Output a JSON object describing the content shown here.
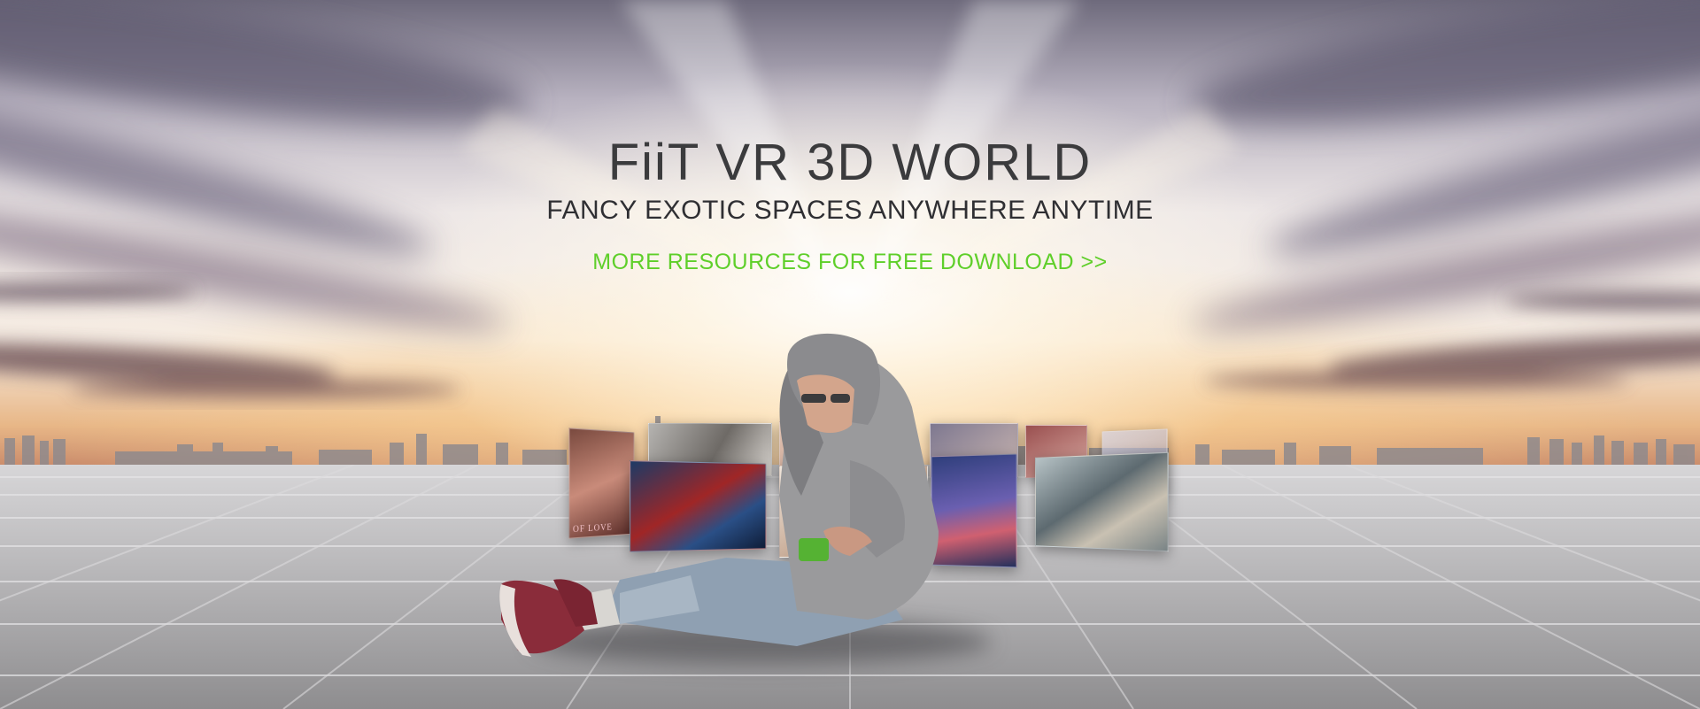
{
  "hero": {
    "title": "FiiT VR 3D WORLD",
    "subtitle": "FANCY EXOTIC SPACES ANYWHERE ANYTIME",
    "cta_label": "MORE RESOURCES FOR FREE DOWNLOAD >>",
    "cta_color": "#5fcf2a"
  },
  "gallery": {
    "tile_caption": "OF LOVE"
  }
}
